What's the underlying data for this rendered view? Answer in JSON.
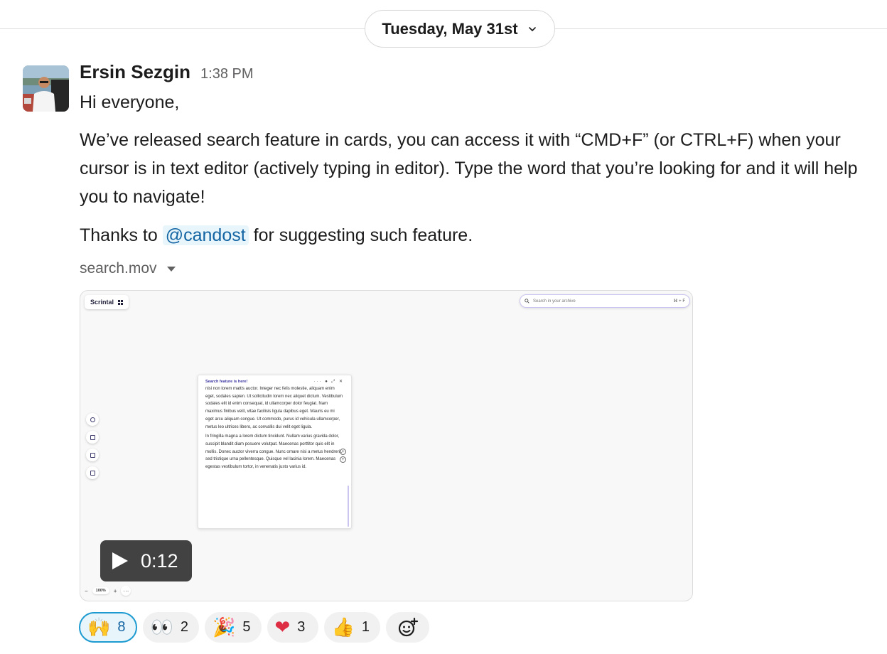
{
  "date_divider": {
    "label": "Tuesday, May 31st"
  },
  "message": {
    "author": "Ersin Sezgin",
    "time": "1:38 PM",
    "greeting": "Hi everyone,",
    "body": "We’ve released search feature in cards, you can access it with “CMD+F” (or CTRL+F) when your cursor is in text editor (actively typing in editor). Type the word that you’re looking for and it will help you to navigate!",
    "thanks_before": "Thanks to ",
    "mention": "@candost",
    "thanks_after": " for suggesting such feature."
  },
  "attachment": {
    "file_name": "search.mov",
    "duration": "0:12",
    "preview": {
      "app_name": "Scrintal",
      "search_placeholder": "Search in your archive",
      "search_shortcut": "⌘ + F",
      "card_title": "Search feature is here!",
      "card_paragraph_1": "nisi non lorem mattis auctor. Integer nec felis molestie, aliquam enim eget, sodales sapien. Ut sollicitudin lorem nec aliquet dictum. Vestibulum sodales elit id enim consequat, id ullamcorper dolor feugiat. Nam maximus finibus velit, vitae facilisis ligula dapibus eget. Mauris eu mi eget arcu aliquam congue. Ut commodo, purus id vehicula ullamcorper, metus leo ultrices libero, ac convallis dui velit eget ligula.",
      "card_paragraph_2": "In fringilla magna a lorem dictum tincidunt. Nullam varius gravida dolor, suscipit blandit diam posuere volutpat. Maecenas porttitor quis elit in mollis. Donec auctor viverra congue. Nunc ornare nisi a metus hendrerit, sed tristique urna pellentesque. Quisque vel lacinia lorem. Maecenas egestas vestibulum tortor, in venenatis justo varius id.",
      "zoom_level": "100%"
    }
  },
  "reactions": [
    {
      "emoji": "🙌",
      "count": "8",
      "active": true
    },
    {
      "emoji": "👀",
      "count": "2",
      "active": false
    },
    {
      "emoji": "🎉",
      "count": "5",
      "active": false
    },
    {
      "emoji": "❤",
      "count": "3",
      "active": false
    },
    {
      "emoji": "👍",
      "count": "1",
      "active": false
    }
  ],
  "icons": {
    "date_chevron": "chevron-down-icon",
    "file_caret": "caret-down-icon",
    "play": "play-icon",
    "add_reaction": "add-reaction-icon"
  },
  "colors": {
    "mention_text": "#1264a3",
    "mention_bg": "#e8f5fa",
    "active_reaction_border": "#1d9bd1"
  }
}
